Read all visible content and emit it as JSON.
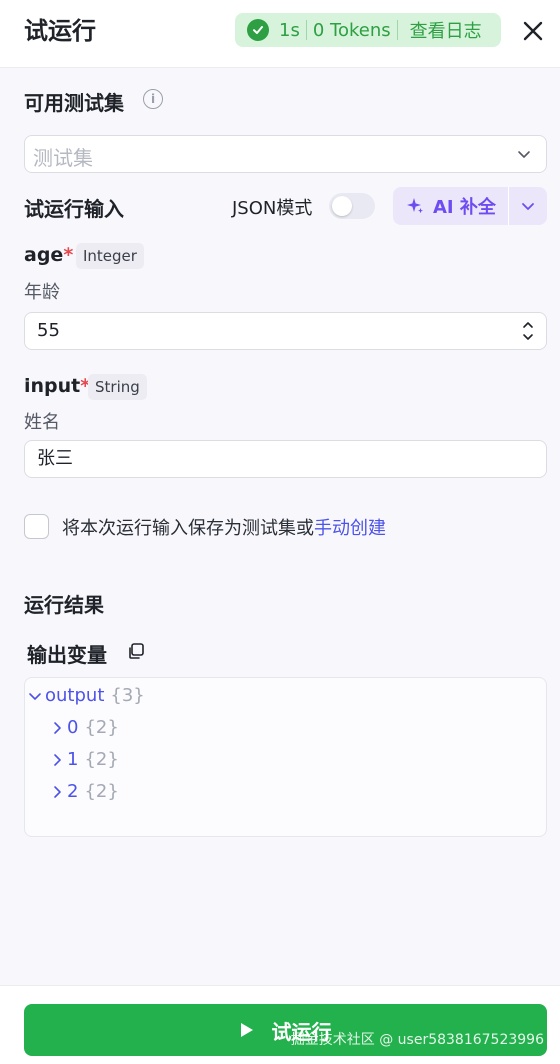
{
  "header": {
    "title": "试运行",
    "status": {
      "time": "1s",
      "tokens": "0 Tokens",
      "log_label": "查看日志"
    }
  },
  "testset": {
    "label": "可用测试集",
    "placeholder": "测试集"
  },
  "input_section": {
    "title": "试运行输入",
    "json_mode_label": "JSON模式",
    "json_mode_on": false,
    "ai_label": "AI 补全"
  },
  "fields": [
    {
      "name": "age",
      "required": "*",
      "type": "Integer",
      "desc": "年龄",
      "value": "55"
    },
    {
      "name": "input",
      "required": "*",
      "type": "String",
      "desc": "姓名",
      "value": "张三"
    }
  ],
  "save": {
    "text": "将本次运行输入保存为测试集或",
    "link": "手动创建",
    "checked": false
  },
  "result": {
    "title": "运行结果",
    "output_title": "输出变量",
    "root": {
      "key": "output",
      "count": "{3}"
    },
    "children": [
      {
        "key": "0",
        "count": "{2}"
      },
      {
        "key": "1",
        "count": "{2}"
      },
      {
        "key": "2",
        "count": "{2}"
      }
    ]
  },
  "run_button": {
    "label": "试运行"
  },
  "watermark": "掘金技术社区 @ user5838167523996",
  "colors": {
    "accent": "#4d53e8",
    "success": "#22b14c",
    "ai": "#6d4df1"
  }
}
